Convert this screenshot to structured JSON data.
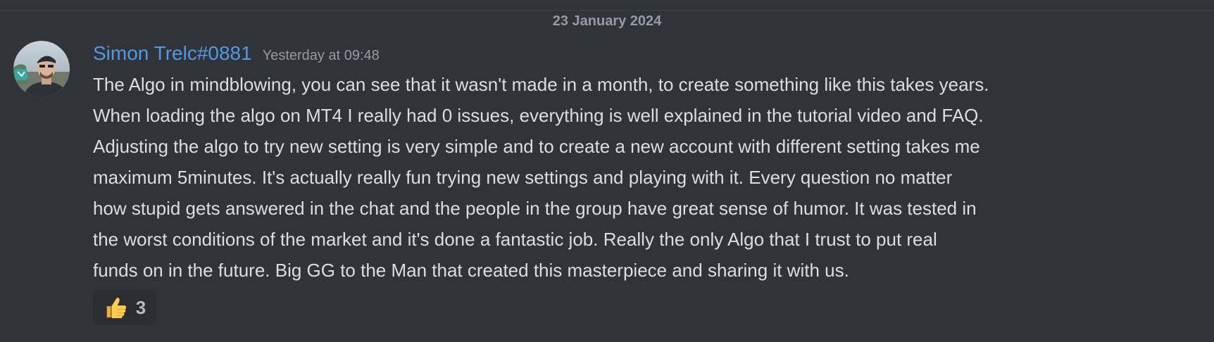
{
  "date_divider": {
    "label": "23 January 2024"
  },
  "message": {
    "author": "Simon Trelc#0881",
    "timestamp": "Yesterday at 09:48",
    "lines": [
      "The Algo in mindblowing, you can see that it wasn't made in a month, to create something like this takes years.",
      "When loading the algo on MT4 I really had 0 issues, everything is well explained in the tutorial video and FAQ.",
      "Adjusting the algo to try new setting is very simple and to create a new account with different setting takes me",
      "maximum 5minutes. It's actually really fun trying new settings and playing with it. Every question no matter",
      "how stupid gets answered in the chat and the people in the group have great sense of humor. It was tested in",
      "the worst conditions of the market and it's done a fantastic job. Really the only Algo that I trust to put real",
      "funds on in the future. Big GG to the Man that created this masterpiece and sharing it with us."
    ],
    "reaction": {
      "emoji": "thumbs-up",
      "count": "3"
    }
  },
  "colors": {
    "background": "#313338",
    "username": "#4d9be6",
    "text": "#dbdee1",
    "muted": "#949ba4",
    "reaction_bg": "#2b2d31"
  }
}
